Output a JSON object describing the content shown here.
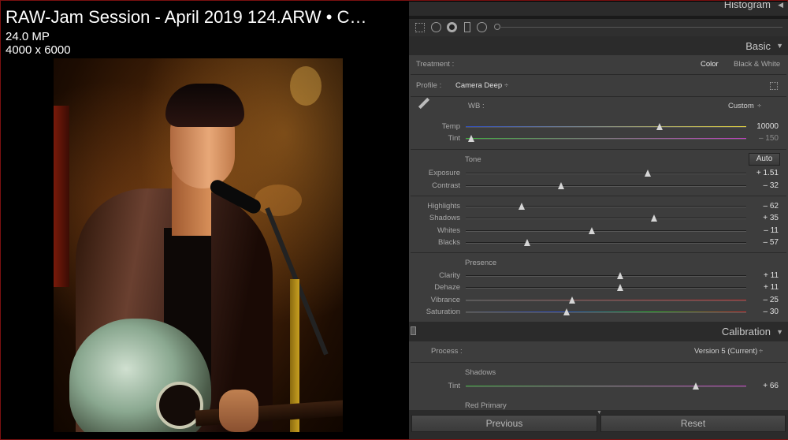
{
  "image_info": {
    "title": "RAW-Jam Session - April 2019 124.ARW • C…",
    "megapixels": "24.0 MP",
    "dimensions": "4000 x 6000"
  },
  "histogram": {
    "title": "Histogram"
  },
  "basic": {
    "title": "Basic",
    "treatment_label": "Treatment :",
    "treatment_color": "Color",
    "treatment_bw": "Black & White",
    "profile_label": "Profile :",
    "profile_value": "Camera Deep",
    "wb_label": "WB :",
    "wb_value": "Custom",
    "temp_label": "Temp",
    "temp_value": "10000",
    "tint_label": "Tint",
    "tint_value": "– 150",
    "tone_label": "Tone",
    "auto_label": "Auto",
    "exposure_label": "Exposure",
    "exposure_value": "+ 1.51",
    "contrast_label": "Contrast",
    "contrast_value": "– 32",
    "highlights_label": "Highlights",
    "highlights_value": "– 62",
    "shadows_label": "Shadows",
    "shadows_value": "+ 35",
    "whites_label": "Whites",
    "whites_value": "– 11",
    "blacks_label": "Blacks",
    "blacks_value": "– 57",
    "presence_label": "Presence",
    "clarity_label": "Clarity",
    "clarity_value": "+ 11",
    "dehaze_label": "Dehaze",
    "dehaze_value": "+ 11",
    "vibrance_label": "Vibrance",
    "vibrance_value": "– 25",
    "saturation_label": "Saturation",
    "saturation_value": "– 30"
  },
  "calibration": {
    "title": "Calibration",
    "process_label": "Process :",
    "process_value": "Version 5 (Current)",
    "shadows_label": "Shadows",
    "tint_label": "Tint",
    "tint_value": "+ 66",
    "red_primary_label": "Red Primary"
  },
  "buttons": {
    "previous": "Previous",
    "reset": "Reset"
  },
  "slider_levels": {
    "temp": 0.69,
    "tint": 0.02,
    "exposure": 0.65,
    "contrast": 0.34,
    "highlights": 0.2,
    "shadows": 0.67,
    "whites": 0.45,
    "blacks": 0.22,
    "clarity": 0.55,
    "dehaze": 0.55,
    "vibrance": 0.38,
    "saturation": 0.36,
    "calib_tint": 0.82
  }
}
